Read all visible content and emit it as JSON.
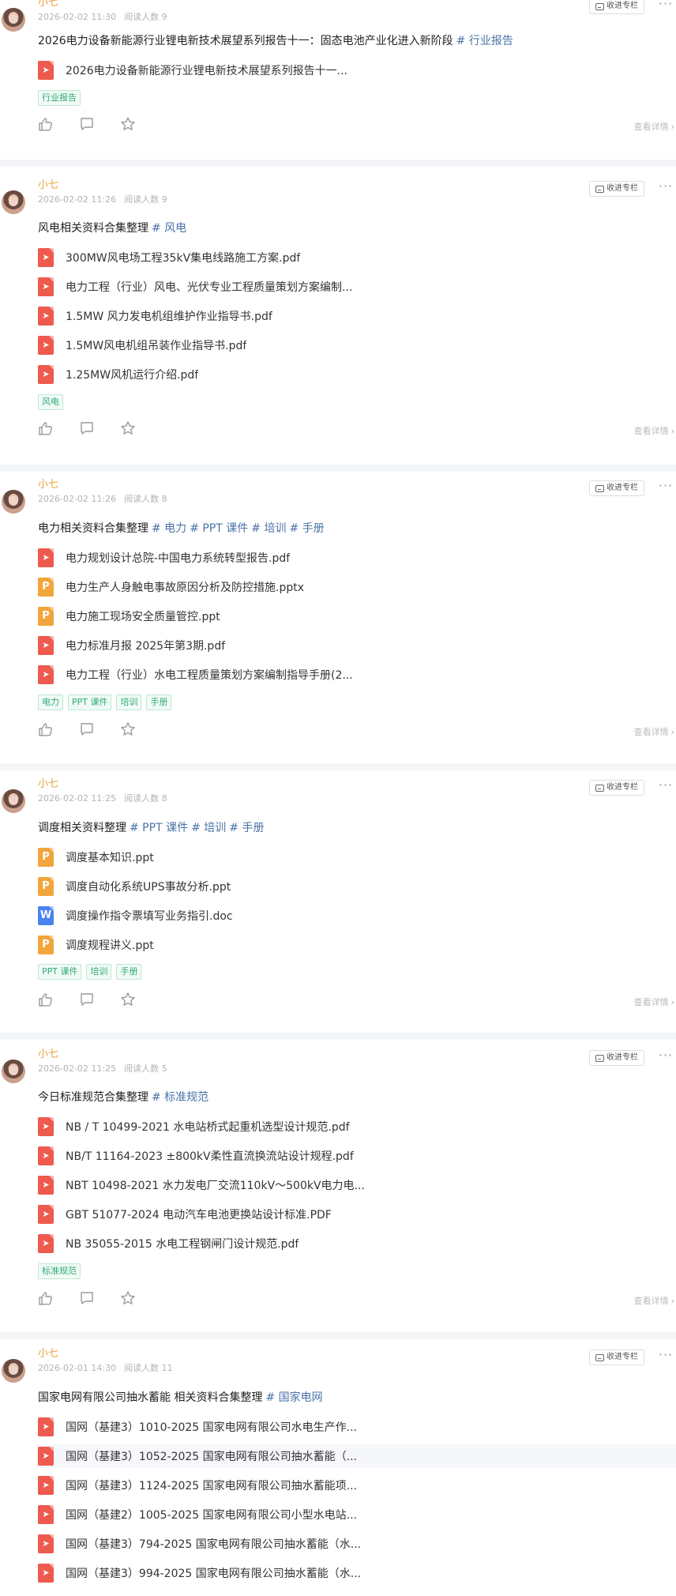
{
  "collect_label": "收进专栏",
  "detail_label": "查看详情",
  "colors": {
    "author": "#e8a23a",
    "tag_text": "#2eaa77",
    "tag_link": "#4a73a8",
    "pdf": "#ee5a4e",
    "ppt": "#f2a53c",
    "doc": "#4a82f0"
  },
  "posts": [
    {
      "author": "小七",
      "time": "2026-02-02 11:30",
      "reads": "阅读人数 9",
      "title": "2026电力设备新能源行业锂电新技术展望系列报告十一：固态电池产业化进入新阶段",
      "title_tags": [
        "# 行业报告"
      ],
      "files": [
        {
          "type": "pdf",
          "icon": "pdf-file-icon",
          "name": "2026电力设备新能源行业锂电新技术展望系列报告十一..."
        }
      ],
      "tags": [
        "行业报告"
      ]
    },
    {
      "author": "小七",
      "time": "2026-02-02 11:26",
      "reads": "阅读人数 9",
      "title": "风电相关资料合集整理",
      "title_tags": [
        "# 风电"
      ],
      "files": [
        {
          "type": "pdf",
          "icon": "pdf-file-icon",
          "name": "300MW风电场工程35kV集电线路施工方案.pdf"
        },
        {
          "type": "pdf",
          "icon": "pdf-file-icon",
          "name": "电力工程（行业）风电、光伏专业工程质量策划方案编制..."
        },
        {
          "type": "pdf",
          "icon": "pdf-file-icon",
          "name": "1.5MW 风力发电机组维护作业指导书.pdf"
        },
        {
          "type": "pdf",
          "icon": "pdf-file-icon",
          "name": "1.5MW风电机组吊装作业指导书.pdf"
        },
        {
          "type": "pdf",
          "icon": "pdf-file-icon",
          "name": "1.25MW风机运行介绍.pdf"
        }
      ],
      "tags": [
        "风电"
      ]
    },
    {
      "author": "小七",
      "time": "2026-02-02 11:26",
      "reads": "阅读人数 8",
      "title": "电力相关资料合集整理",
      "title_tags": [
        "# 电力",
        "# PPT 课件",
        "# 培训",
        "# 手册"
      ],
      "files": [
        {
          "type": "pdf",
          "icon": "pdf-file-icon",
          "name": "电力规划设计总院-中国电力系统转型报告.pdf"
        },
        {
          "type": "ppt",
          "icon": "ppt-file-icon",
          "name": "电力生产人身触电事故原因分析及防控措施.pptx"
        },
        {
          "type": "ppt",
          "icon": "ppt-file-icon",
          "name": "电力施工现场安全质量管控.ppt"
        },
        {
          "type": "pdf",
          "icon": "pdf-file-icon",
          "name": "电力标准月报 2025年第3期.pdf"
        },
        {
          "type": "pdf",
          "icon": "pdf-file-icon",
          "name": "电力工程（行业）水电工程质量策划方案编制指导手册(2..."
        }
      ],
      "tags": [
        "电力",
        "PPT 课件",
        "培训",
        "手册"
      ]
    },
    {
      "author": "小七",
      "time": "2026-02-02 11:25",
      "reads": "阅读人数 8",
      "title": "调度相关资料整理",
      "title_tags": [
        "# PPT 课件",
        "# 培训",
        "# 手册"
      ],
      "files": [
        {
          "type": "ppt",
          "icon": "ppt-file-icon",
          "name": "调度基本知识.ppt"
        },
        {
          "type": "ppt",
          "icon": "ppt-file-icon",
          "name": "调度自动化系统UPS事故分析.ppt"
        },
        {
          "type": "doc",
          "icon": "word-file-icon",
          "name": "调度操作指令票填写业务指引.doc"
        },
        {
          "type": "ppt",
          "icon": "ppt-file-icon",
          "name": "调度规程讲义.ppt"
        }
      ],
      "tags": [
        "PPT 课件",
        "培训",
        "手册"
      ]
    },
    {
      "author": "小七",
      "time": "2026-02-02 11:25",
      "reads": "阅读人数 5",
      "title": "今日标准规范合集整理",
      "title_tags": [
        "# 标准规范"
      ],
      "files": [
        {
          "type": "pdf",
          "icon": "pdf-file-icon",
          "name": "NB / T 10499-2021 水电站桥式起重机选型设计规范.pdf"
        },
        {
          "type": "pdf",
          "icon": "pdf-file-icon",
          "name": "NB/T 11164-2023 ±800kV柔性直流换流站设计规程.pdf"
        },
        {
          "type": "pdf",
          "icon": "pdf-file-icon",
          "name": "NBT 10498-2021 水力发电厂交流110kV～500kV电力电..."
        },
        {
          "type": "pdf",
          "icon": "pdf-file-icon",
          "name": "GBT 51077-2024 电动汽车电池更换站设计标准.PDF"
        },
        {
          "type": "pdf",
          "icon": "pdf-file-icon",
          "name": "NB 35055-2015 水电工程钢闸门设计规范.pdf"
        }
      ],
      "tags": [
        "标准规范"
      ]
    },
    {
      "author": "小七",
      "time": "2026-02-01 14:30",
      "reads": "阅读人数 11",
      "title": "国家电网有限公司抽水蓄能 相关资料合集整理",
      "title_tags": [
        "# 国家电网"
      ],
      "files": [
        {
          "type": "pdf",
          "icon": "pdf-file-icon",
          "name": "国网（基建3）1010-2025 国家电网有限公司水电生产作..."
        },
        {
          "type": "pdf",
          "icon": "pdf-file-icon",
          "name": "国网（基建3）1052-2025 国家电网有限公司抽水蓄能（..."
        },
        {
          "type": "pdf",
          "icon": "pdf-file-icon",
          "name": "国网（基建3）1124-2025 国家电网有限公司抽水蓄能项..."
        },
        {
          "type": "pdf",
          "icon": "pdf-file-icon",
          "name": "国网（基建2）1005-2025 国家电网有限公司小型水电站..."
        },
        {
          "type": "pdf",
          "icon": "pdf-file-icon",
          "name": "国网（基建3）794-2025 国家电网有限公司抽水蓄能（水..."
        },
        {
          "type": "pdf",
          "icon": "pdf-file-icon",
          "name": "国网（基建3）994-2025 国家电网有限公司抽水蓄能（水..."
        }
      ],
      "tags": []
    }
  ]
}
